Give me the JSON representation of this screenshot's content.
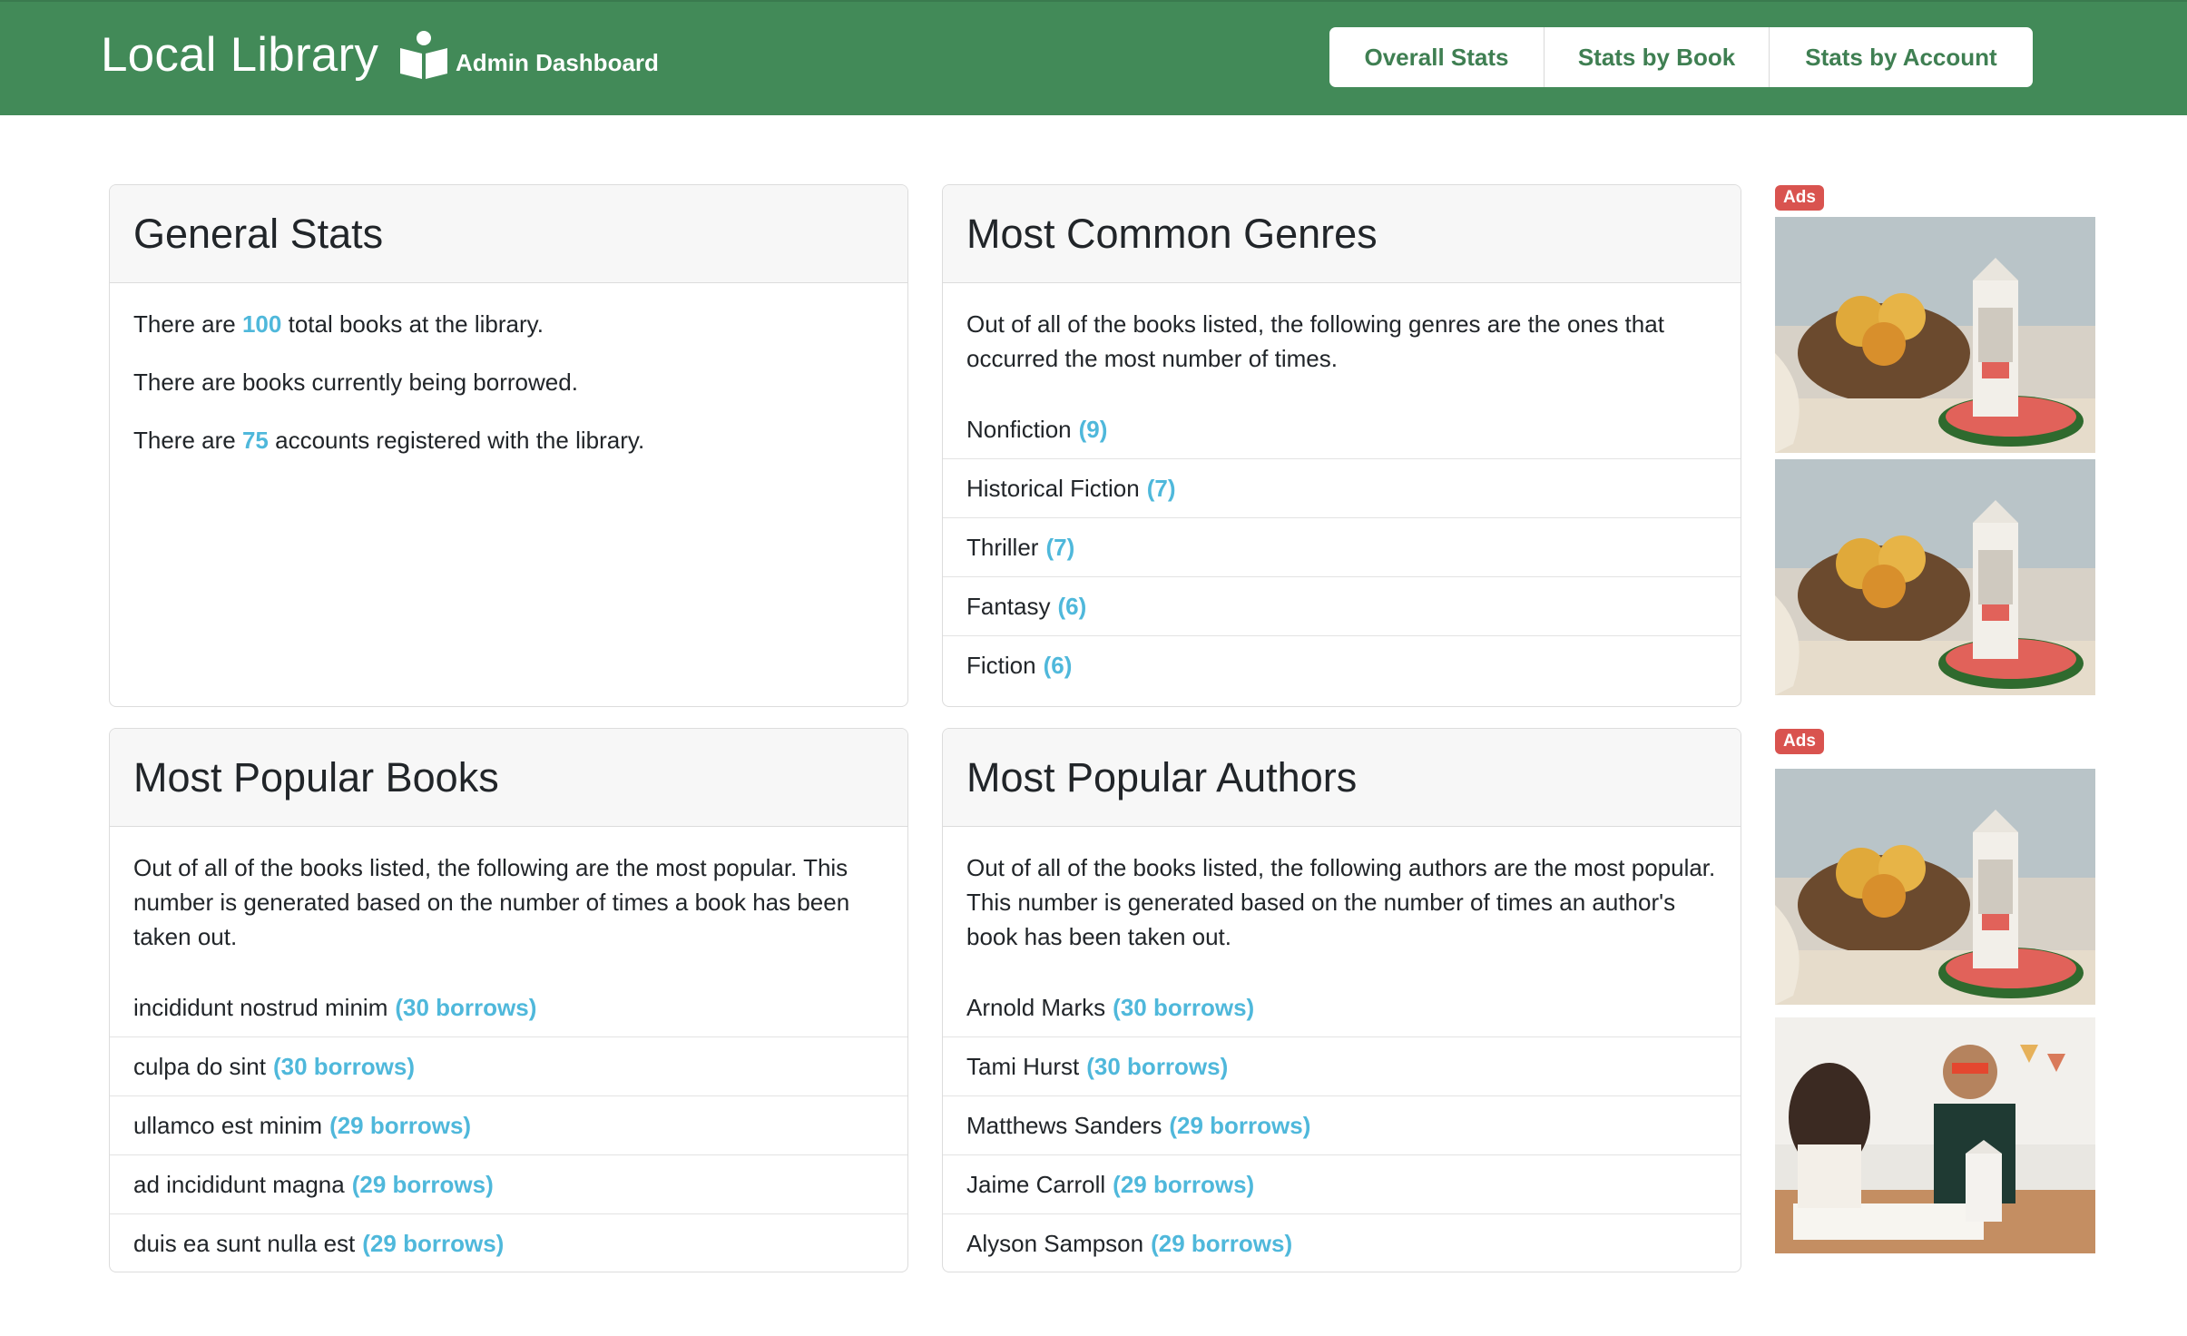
{
  "header": {
    "title": "Local Library",
    "subtitle": "Admin Dashboard",
    "brand_icon": "book-reader-icon",
    "nav": [
      {
        "label": "Overall Stats"
      },
      {
        "label": "Stats by Book"
      },
      {
        "label": "Stats by Account"
      }
    ]
  },
  "general_stats": {
    "title": "General Stats",
    "total_books": {
      "prefix": "There are",
      "value": "100",
      "suffix": "total books at the library."
    },
    "borrowed": {
      "text": "There are books currently being borrowed."
    },
    "accounts": {
      "prefix": "There are",
      "value": "75",
      "suffix": "accounts registered with the library."
    }
  },
  "genres": {
    "title": "Most Common Genres",
    "intro": "Out of all of the books listed, the following genres are the ones that occurred the most number of times.",
    "items": [
      {
        "name": "Nonfiction",
        "count": "(9)"
      },
      {
        "name": "Historical Fiction",
        "count": "(7)"
      },
      {
        "name": "Thriller",
        "count": "(7)"
      },
      {
        "name": "Fantasy",
        "count": "(6)"
      },
      {
        "name": "Fiction",
        "count": "(6)"
      }
    ]
  },
  "books": {
    "title": "Most Popular Books",
    "intro": "Out of all of the books listed, the following are the most popular. This number is generated based on the number of times a book has been taken out.",
    "items": [
      {
        "name": "incididunt nostrud minim",
        "count": "(30 borrows)"
      },
      {
        "name": "culpa do sint",
        "count": "(30 borrows)"
      },
      {
        "name": "ullamco est minim",
        "count": "(29 borrows)"
      },
      {
        "name": "ad incididunt magna",
        "count": "(29 borrows)"
      },
      {
        "name": "duis ea sunt nulla est",
        "count": "(29 borrows)"
      }
    ]
  },
  "authors": {
    "title": "Most Popular Authors",
    "intro": "Out of all of the books listed, the following authors are the most popular. This number is generated based on the number of times an author's book has been taken out.",
    "items": [
      {
        "name": "Arnold Marks",
        "count": "(30 borrows)"
      },
      {
        "name": "Tami Hurst",
        "count": "(30 borrows)"
      },
      {
        "name": "Matthews Sanders",
        "count": "(29 borrows)"
      },
      {
        "name": "Jaime Carroll",
        "count": "(29 borrows)"
      },
      {
        "name": "Alyson Sampson",
        "count": "(29 borrows)"
      }
    ]
  },
  "ads": {
    "badge_label": "Ads",
    "badge_color": "#d9534f",
    "images": [
      {
        "depicts": "fruit-bowl-water-carton-photo"
      },
      {
        "depicts": "fruit-bowl-water-carton-photo"
      },
      {
        "depicts": "fruit-bowl-water-carton-photo"
      },
      {
        "depicts": "family-table-water-carton-photo"
      }
    ]
  },
  "colors": {
    "header_bg": "#428a58",
    "nav_text": "#3f7f52",
    "highlight": "#4fb8db",
    "ads_badge": "#d9534f"
  }
}
